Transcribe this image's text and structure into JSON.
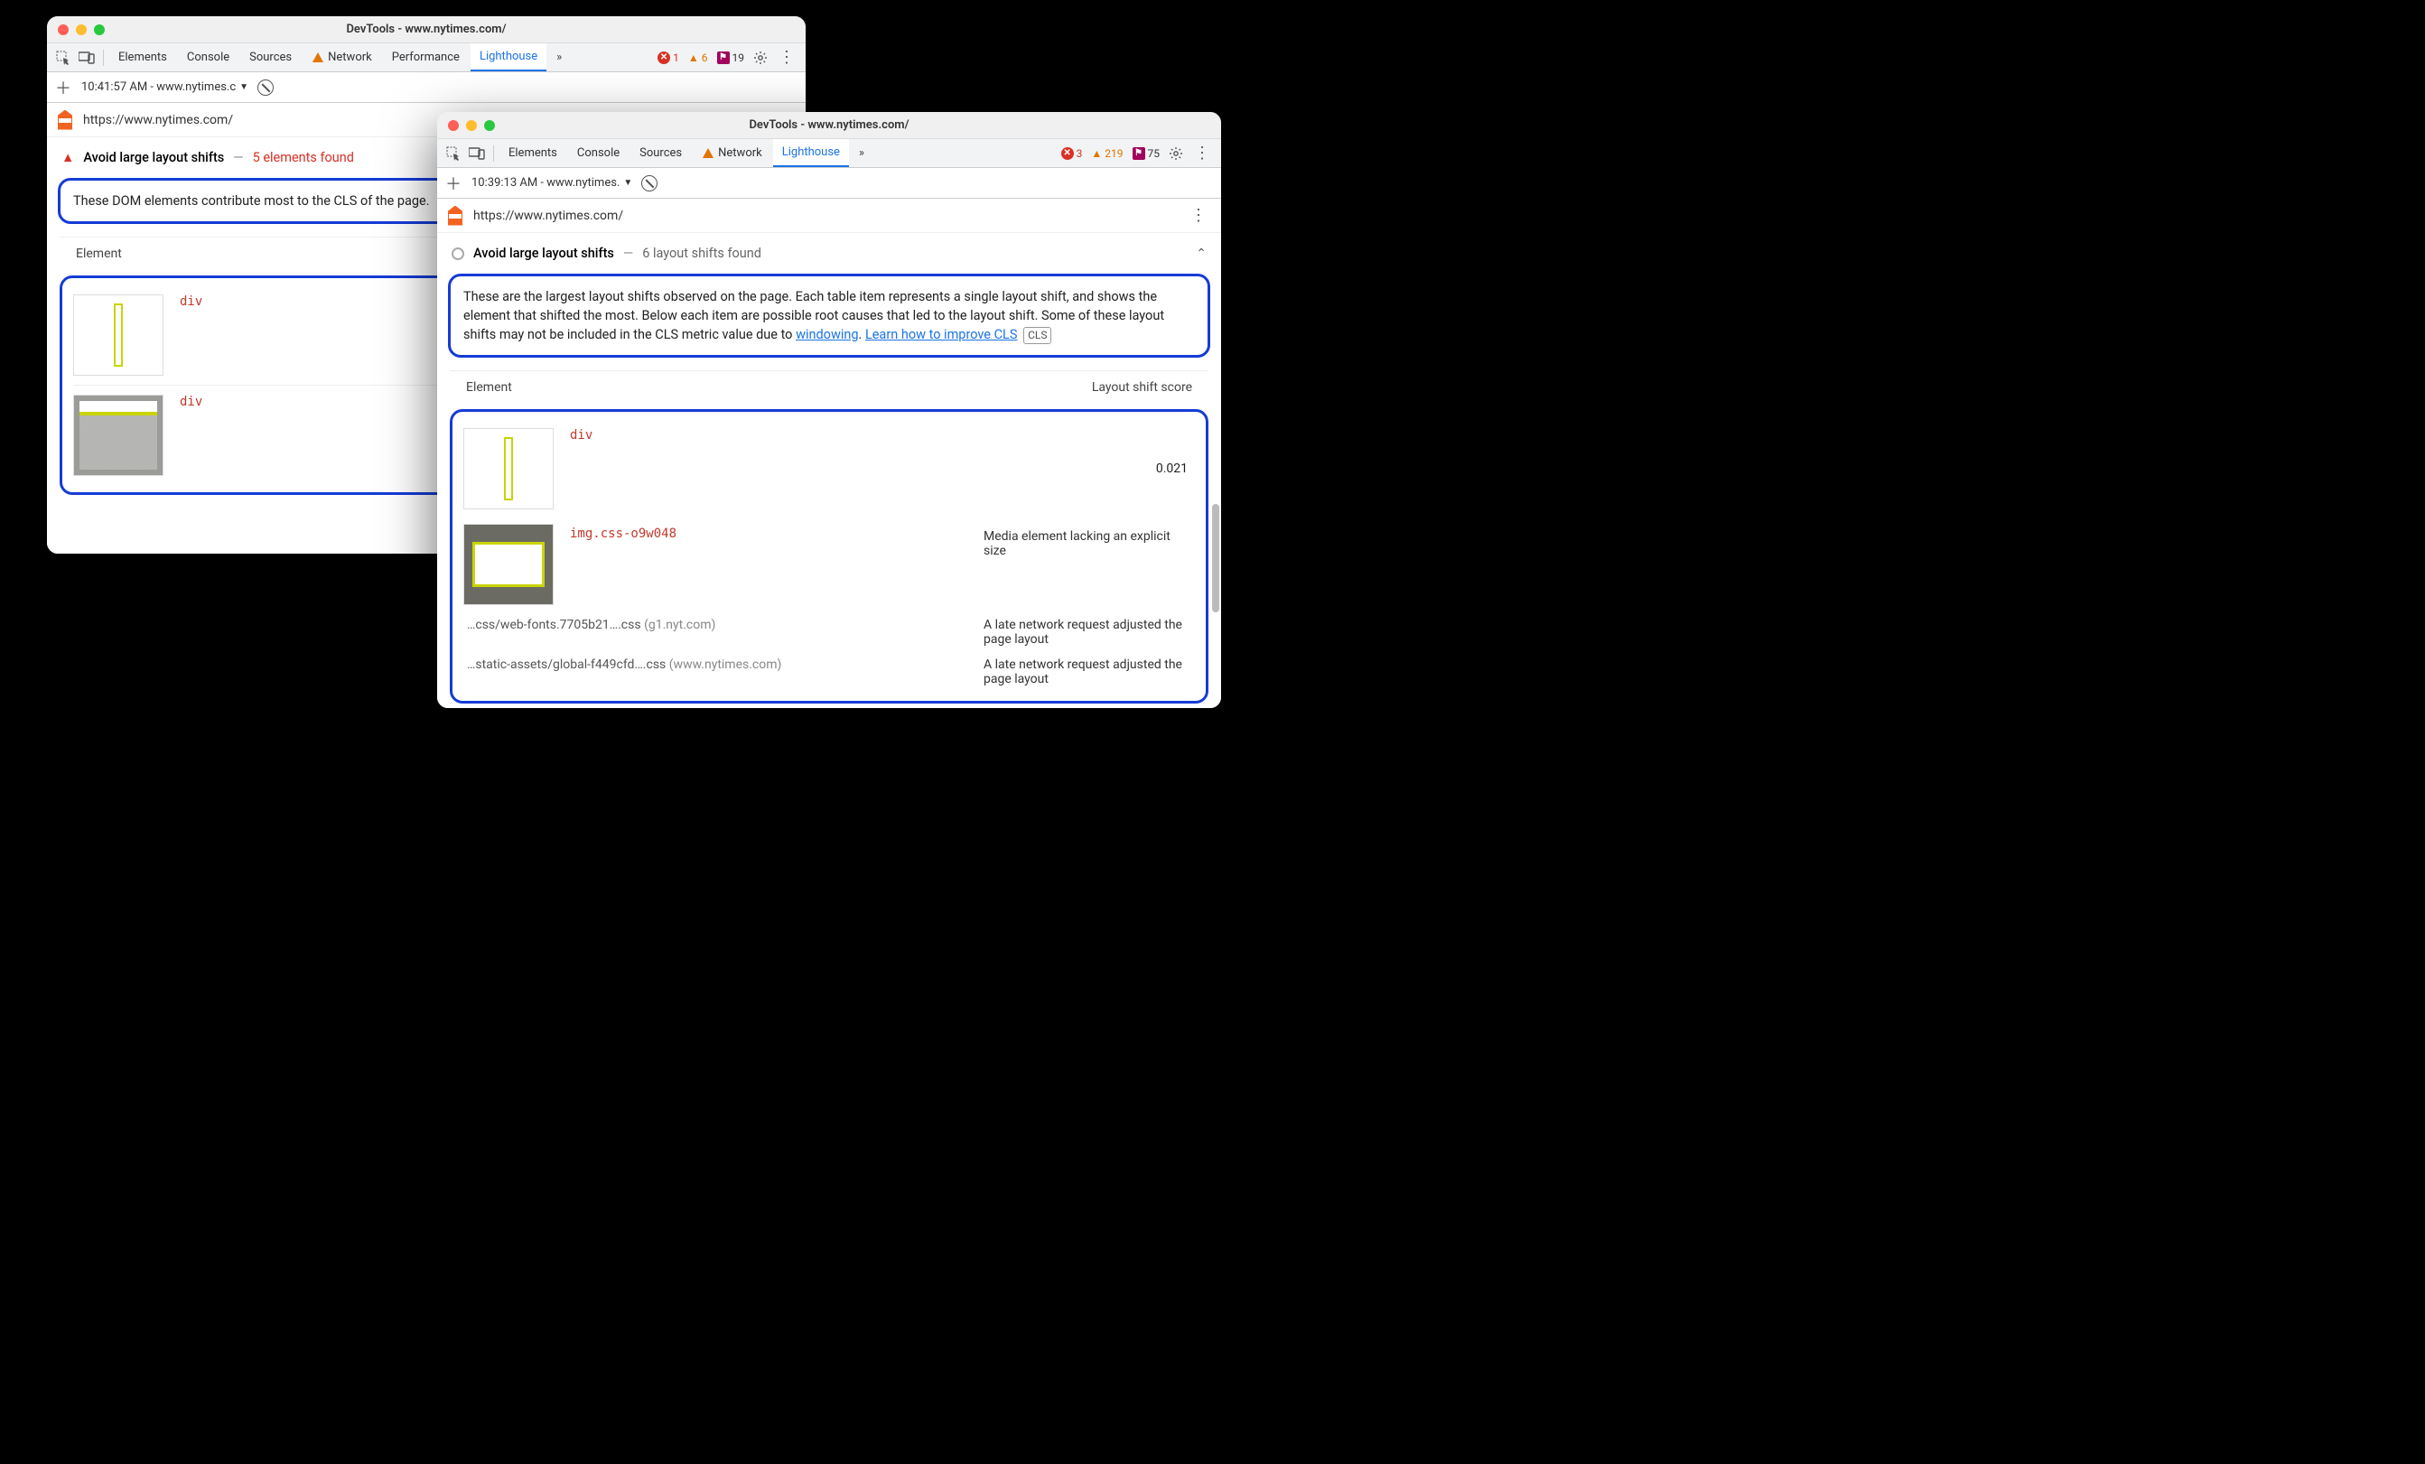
{
  "windowA": {
    "title": "DevTools - www.nytimes.com/",
    "tabs": {
      "elements": "Elements",
      "console": "Console",
      "sources": "Sources",
      "network": "Network",
      "performance": "Performance",
      "lighthouse": "Lighthouse"
    },
    "counts": {
      "errors": "1",
      "warnings": "6",
      "violations": "19"
    },
    "subbar_time": "10:41:57 AM - www.nytimes.c",
    "url": "https://www.nytimes.com/",
    "audit": {
      "title": "Avoid large layout shifts",
      "sub": "5 elements found",
      "dash": "—"
    },
    "desc": "These DOM elements contribute most to the CLS of the page.",
    "hdr_element": "Element",
    "entries": [
      {
        "code": "div"
      },
      {
        "code": "div"
      }
    ]
  },
  "windowB": {
    "title": "DevTools - www.nytimes.com/",
    "tabs": {
      "elements": "Elements",
      "console": "Console",
      "sources": "Sources",
      "network": "Network",
      "lighthouse": "Lighthouse"
    },
    "counts": {
      "errors": "3",
      "warnings": "219",
      "violations": "75"
    },
    "subbar_time": "10:39:13 AM - www.nytimes.",
    "url": "https://www.nytimes.com/",
    "audit": {
      "title": "Avoid large layout shifts",
      "sub": "6 layout shifts found",
      "dash": "—"
    },
    "desc_pre": "These are the largest layout shifts observed on the page. Each table item represents a single layout shift, and shows the element that shifted the most. Below each item are possible root causes that led to the layout shift. Some of these layout shifts may not be included in the CLS metric value due to ",
    "desc_link1": "windowing",
    "desc_mid": ". ",
    "desc_link2": "Learn how to improve CLS",
    "cls_chip": "CLS",
    "hdr_element": "Element",
    "hdr_score": "Layout shift score",
    "entry1": {
      "code": "div",
      "score": "0.021"
    },
    "entry2": {
      "code": "img.css-o9w048",
      "cause": "Media element lacking an explicit size"
    },
    "entry3": {
      "left": "…css/web-fonts.7705b21….css",
      "dom": "(g1.nyt.com)",
      "right": "A late network request adjusted the page layout"
    },
    "entry4": {
      "left": "…static-assets/global-f449cfd….css",
      "dom": "(www.nytimes.com)",
      "right": "A late network request adjusted the page layout"
    }
  }
}
